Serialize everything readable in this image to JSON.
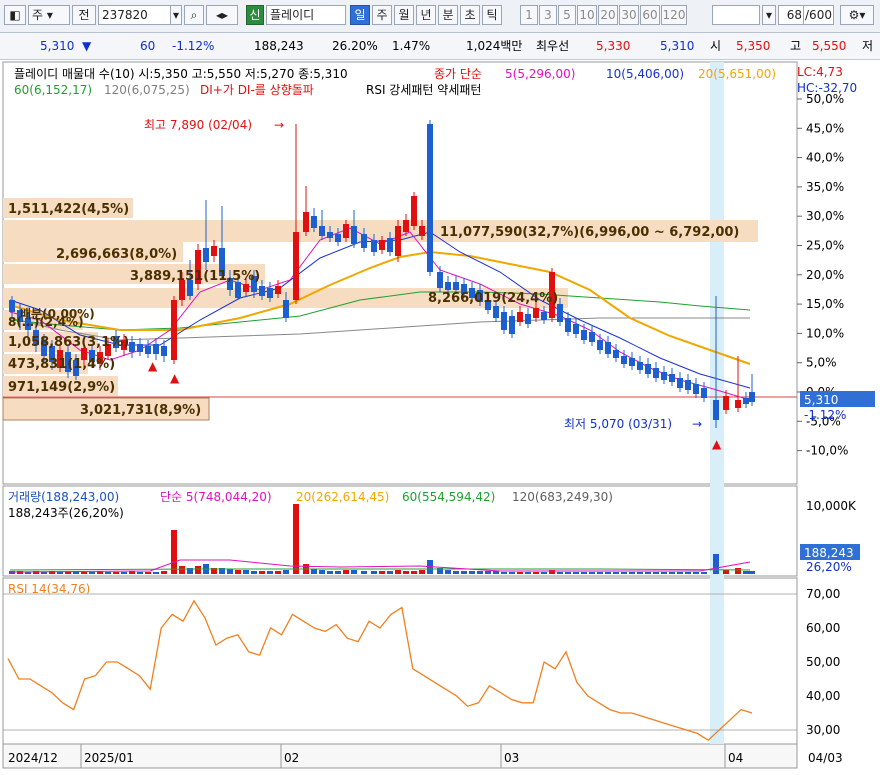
{
  "toolbar": {
    "market": "주",
    "scope": "전",
    "code": "237820",
    "badge": "신",
    "name": "플레이디",
    "period_tabs": [
      "일",
      "주",
      "월",
      "년",
      "분",
      "초",
      "틱"
    ],
    "numbers": [
      "1",
      "3",
      "5",
      "10",
      "20",
      "30",
      "60",
      "120"
    ],
    "page_counter": "68",
    "page_total": "/600"
  },
  "infobar": {
    "price": "5,310",
    "change": "60",
    "change_pct": "-1.12%",
    "volume": "188,243",
    "vol_ratio": "26.20%",
    "turnover": "1.47%",
    "amount": "1,024백만",
    "bid_label": "최우선",
    "ask": "5,330",
    "bid": "5,310",
    "open_label": "시",
    "open": "5,350",
    "high_label": "고",
    "high": "5,550",
    "low_label": "저"
  },
  "price_panel": {
    "legend_title": "플레이디 매물대 수(10)  시:5,350 고:5,550 저:5,270 종:5,310",
    "legend_ma_label": "종가 단순",
    "ma5": "5(5,296,00)",
    "ma10": "10(5,406,00)",
    "ma20": "20(5,651,00)",
    "ma60": "60(6,152,17)",
    "ma120": "120(6,075,25)",
    "signal1": "DI+가 DI-를 상향돌파",
    "signal2": "RSI 강세패턴  약세패턴",
    "lc": "LC:4,73",
    "hc": "HC:-32,70",
    "high_note": "최고 7,890 (02/04)",
    "low_note": "최저 5,070 (03/31)",
    "price_tag": "5,310",
    "pct_tag": "-1.12%",
    "volume_profile": [
      "1,511,422(4,5%)",
      "2,696,663(8,0%)",
      "3,889,151(11,5%)",
      "11,077,590(32,7%)(6,996,00 ~ 6,792,00)",
      "8,266,019(24,4%)",
      "배분(0,00%)",
      "8(…)(2,4%)",
      "1,058,863(3,1%)",
      "473,831(1,4%)",
      "971,149(2,9%)",
      "3,021,731(8,9%)"
    ],
    "axis_labels": [
      "50,0%",
      "45,0%",
      "40,0%",
      "35,0%",
      "30,0%",
      "25,0%",
      "20,0%",
      "15,0%",
      "10,0%",
      "5,0%",
      "0,0%",
      "-5,0%",
      "-10,0%"
    ]
  },
  "volume_panel": {
    "legend_vol": "거래량(188,243,00)",
    "legend_ma5": "단순 5(748,044,20)",
    "legend_ma20": "20(262,614,45)",
    "legend_ma60": "60(554,594,42)",
    "legend_ma120": "120(683,249,30)",
    "sub_label": "188,243주(26,20%)",
    "axis_top": "10,000K",
    "tag_value": "188,243",
    "tag_pct": "26,20%"
  },
  "rsi_panel": {
    "legend": "RSI 14(34,76)",
    "axis_labels": [
      "70,00",
      "60,00",
      "50,00",
      "40,00",
      "30,00"
    ],
    "values": [
      51,
      45,
      45,
      43,
      41,
      38,
      36,
      45,
      46,
      50,
      50,
      48,
      46,
      42,
      60,
      64,
      62,
      68,
      63,
      55,
      57,
      58,
      53,
      52,
      60,
      58,
      64,
      62,
      60,
      59,
      61,
      57,
      56,
      62,
      60,
      64,
      66,
      48,
      46,
      44,
      42,
      40,
      37,
      38,
      43,
      41,
      39,
      38,
      38,
      50,
      48,
      53,
      44,
      40,
      38,
      36,
      35,
      35,
      34,
      33,
      32,
      31,
      30,
      29,
      27,
      30,
      33,
      36,
      35
    ]
  },
  "xaxis": {
    "labels": [
      "2024/12",
      "2025/01",
      "02",
      "03",
      "04",
      "04/03"
    ]
  },
  "colors": {
    "up": "#e01010",
    "down": "#1e5fd0",
    "ma5": "#e010c0",
    "ma10": "#1a2fd6",
    "ma20": "#f0a800",
    "ma60": "#20a030",
    "ma120": "#808080",
    "profile": "#f6dcc0",
    "rsi": "#f08020"
  }
}
